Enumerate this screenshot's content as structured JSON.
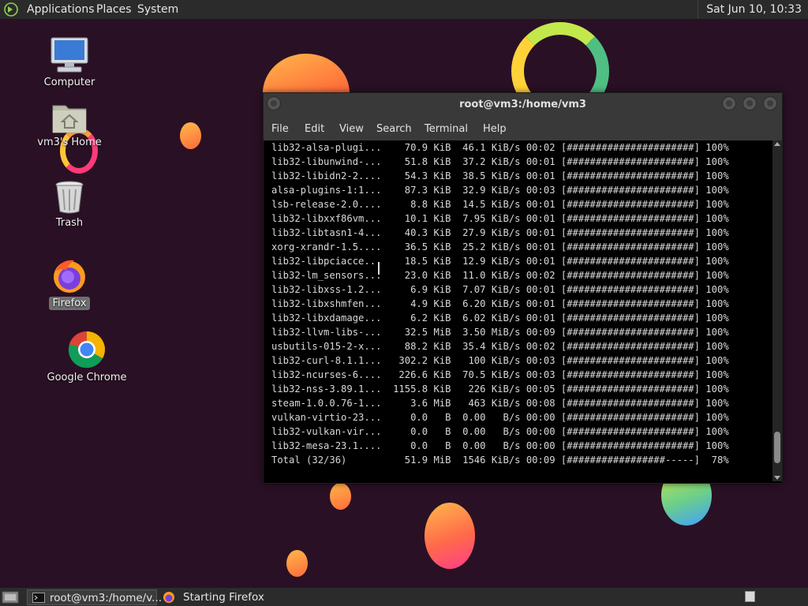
{
  "top_panel": {
    "menus": [
      "Applications",
      "Places",
      "System"
    ],
    "clock": "Sat Jun 10, 10:33"
  },
  "desktop_icons": [
    "Computer",
    "vm3's Home",
    "Trash",
    "Firefox",
    "Google Chrome"
  ],
  "terminal": {
    "title": "root@vm3:/home/vm3",
    "menu": [
      "File",
      "Edit",
      "View",
      "Search",
      "Terminal",
      "Help"
    ],
    "lines": [
      "lib32-alsa-plugi...    70.9 KiB  46.1 KiB/s 00:02 [######################] 100%",
      "lib32-libunwind-...    51.8 KiB  37.2 KiB/s 00:01 [######################] 100%",
      "lib32-libidn2-2....    54.3 KiB  38.5 KiB/s 00:01 [######################] 100%",
      "alsa-plugins-1:1...    87.3 KiB  32.9 KiB/s 00:03 [######################] 100%",
      "lsb-release-2.0....     8.8 KiB  14.5 KiB/s 00:01 [######################] 100%",
      "lib32-libxxf86vm...    10.1 KiB  7.95 KiB/s 00:01 [######################] 100%",
      "lib32-libtasn1-4...    40.3 KiB  27.9 KiB/s 00:01 [######################] 100%",
      "xorg-xrandr-1.5....    36.5 KiB  25.2 KiB/s 00:01 [######################] 100%",
      "lib32-libpciacce...    18.5 KiB  12.9 KiB/s 00:01 [######################] 100%",
      "lib32-lm_sensors...    23.0 KiB  11.0 KiB/s 00:02 [######################] 100%",
      "lib32-libxss-1.2...     6.9 KiB  7.07 KiB/s 00:01 [######################] 100%",
      "lib32-libxshmfen...     4.9 KiB  6.20 KiB/s 00:01 [######################] 100%",
      "lib32-libxdamage...     6.2 KiB  6.02 KiB/s 00:01 [######################] 100%",
      "lib32-llvm-libs-...    32.5 MiB  3.50 MiB/s 00:09 [######################] 100%",
      "usbutils-015-2-x...    88.2 KiB  35.4 KiB/s 00:02 [######################] 100%",
      "lib32-curl-8.1.1...   302.2 KiB   100 KiB/s 00:03 [######################] 100%",
      "lib32-ncurses-6....   226.6 KiB  70.5 KiB/s 00:03 [######################] 100%",
      "lib32-nss-3.89.1...  1155.8 KiB   226 KiB/s 00:05 [######################] 100%",
      "steam-1.0.0.76-1...     3.6 MiB   463 KiB/s 00:08 [######################] 100%",
      "vulkan-virtio-23...     0.0   B  0.00   B/s 00:00 [######################] 100%",
      "lib32-vulkan-vir...     0.0   B  0.00   B/s 00:00 [######################] 100%",
      "lib32-mesa-23.1....     0.0   B  0.00   B/s 00:00 [######################] 100%",
      "Total (32/36)          51.9 MiB  1546 KiB/s 00:09 [#################-----]  78%"
    ],
    "scroll_position": 0.97
  },
  "taskbar": {
    "tasks": [
      "root@vm3:/home/v...",
      "Starting Firefox"
    ]
  },
  "colors": {
    "background": "#2a1024",
    "panel": "#2b2b2b",
    "terminal_bg": "#000000",
    "terminal_fg": "#d8d8d8"
  }
}
